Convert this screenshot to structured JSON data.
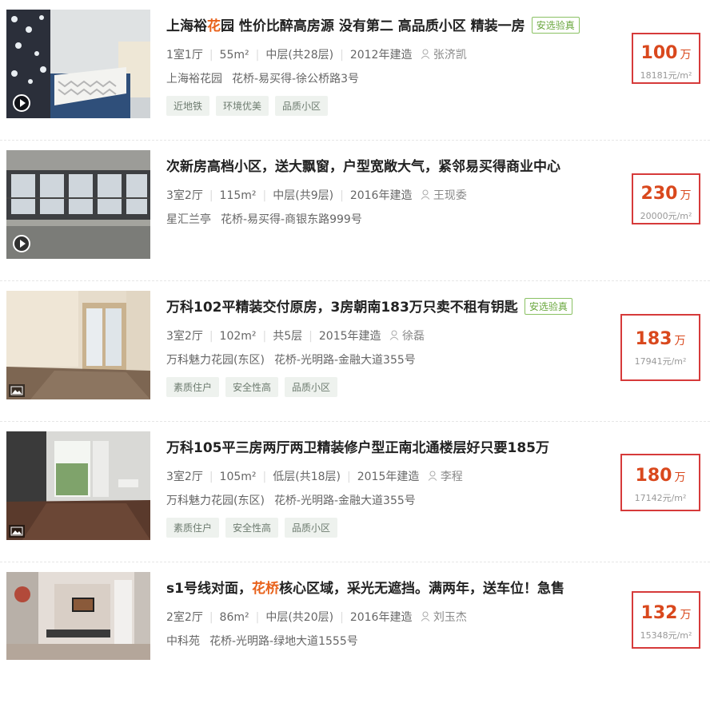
{
  "listings": [
    {
      "title_pre": "上海裕",
      "title_hl": "花",
      "title_post": "园 性价比醉高房源 没有第二 高品质小区 精装一房",
      "verify": "安选验真",
      "layout": "1室1厅",
      "area": "55m²",
      "floor": "中层(共28层)",
      "year": "2012年建造",
      "agent": "张济凯",
      "community": "上海裕花园",
      "location": "花桥-易买得-徐公桥路3号",
      "tags": [
        "近地铁",
        "环境优美",
        "品质小区"
      ],
      "price": "100",
      "price_unit": "万",
      "unit_price": "18181元/m²",
      "media": "video"
    },
    {
      "title_pre": "次新房高档小区，送大飘窗，户型宽敞大气，紧邻易买得商业中心",
      "title_hl": "",
      "title_post": "",
      "verify": "",
      "layout": "3室2厅",
      "area": "115m²",
      "floor": "中层(共9层)",
      "year": "2016年建造",
      "agent": "王现委",
      "community": "星汇兰亭",
      "location": "花桥-易买得-商银东路999号",
      "tags": [],
      "price": "230",
      "price_unit": "万",
      "unit_price": "20000元/m²",
      "media": "video"
    },
    {
      "title_pre": "万科102平精装交付原房，3房朝南183万只卖不租有钥匙",
      "title_hl": "",
      "title_post": "",
      "verify": "安选验真",
      "layout": "3室2厅",
      "area": "102m²",
      "floor": "共5层",
      "year": "2015年建造",
      "agent": "徐磊",
      "community": "万科魅力花园(东区)",
      "location": "花桥-光明路-金融大道355号",
      "tags": [
        "素质住户",
        "安全性高",
        "品质小区"
      ],
      "price": "183",
      "price_unit": "万",
      "unit_price": "17941元/m²",
      "media": "image"
    },
    {
      "title_pre": "万科105平三房两厅两卫精装修户型正南北通楼层好只要185万",
      "title_hl": "",
      "title_post": "",
      "verify": "",
      "layout": "3室2厅",
      "area": "105m²",
      "floor": "低层(共18层)",
      "year": "2015年建造",
      "agent": "李程",
      "community": "万科魅力花园(东区)",
      "location": "花桥-光明路-金融大道355号",
      "tags": [
        "素质住户",
        "安全性高",
        "品质小区"
      ],
      "price": "180",
      "price_unit": "万",
      "unit_price": "17142元/m²",
      "media": "image"
    },
    {
      "title_pre": "s1号线对面，",
      "title_hl": "花桥",
      "title_post": "核心区域，采光无遮挡。满两年，送车位！急售",
      "verify": "",
      "layout": "2室2厅",
      "area": "86m²",
      "floor": "中层(共20层)",
      "year": "2016年建造",
      "agent": "刘玉杰",
      "community": "中科苑",
      "location": "花桥-光明路-绿地大道1555号",
      "tags": [],
      "price": "132",
      "price_unit": "万",
      "unit_price": "15348元/m²",
      "media": "none"
    }
  ],
  "colors": {
    "price": "#d9481d",
    "highlight": "#e8611a",
    "box_border": "#d63a3a",
    "verify": "#6aa73e"
  }
}
